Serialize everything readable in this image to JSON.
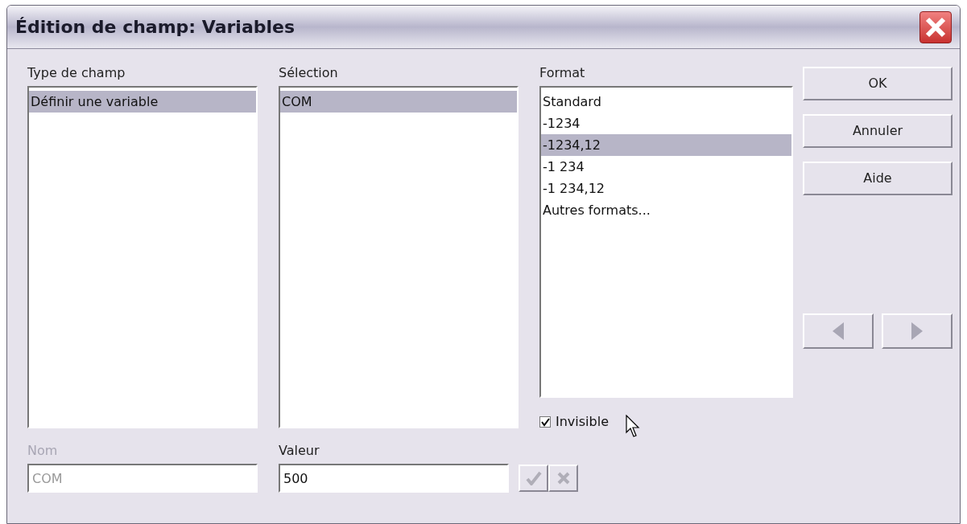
{
  "window": {
    "title": "Édition de champ: Variables"
  },
  "lists": [
    {
      "label": "Type de champ",
      "items": [
        {
          "text": "Définir une variable",
          "selected": true
        }
      ]
    },
    {
      "label": "Sélection",
      "items": [
        {
          "text": "COM",
          "selected": true
        }
      ]
    },
    {
      "label": "Format",
      "items": [
        {
          "text": "Standard",
          "selected": false
        },
        {
          "text": "-1234",
          "selected": false
        },
        {
          "text": "-1234,12",
          "selected": true
        },
        {
          "text": "-1 234",
          "selected": false
        },
        {
          "text": "-1 234,12",
          "selected": false
        },
        {
          "text": "Autres formats...",
          "selected": false
        }
      ]
    }
  ],
  "invisible": {
    "label": "Invisible",
    "checked": true
  },
  "buttons": [
    "OK",
    "Annuler",
    "Aide"
  ],
  "nav_buttons": [
    {
      "kind": "previous",
      "disabled": true
    },
    {
      "kind": "next",
      "disabled": true
    }
  ],
  "fields": [
    {
      "label": "Nom",
      "value": "COM",
      "disabled": true
    },
    {
      "label": "Valeur",
      "value": "500",
      "disabled": false
    }
  ],
  "value_buttons": [
    {
      "kind": "apply",
      "disabled": true
    },
    {
      "kind": "cancel",
      "disabled": true
    }
  ]
}
